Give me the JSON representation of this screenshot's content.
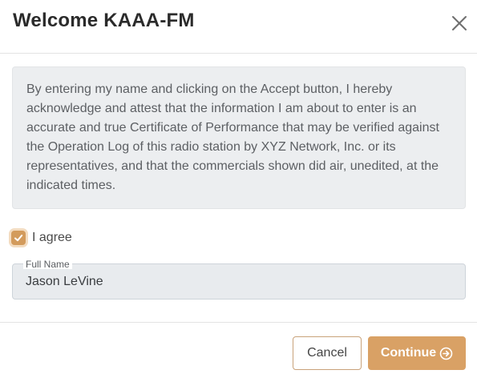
{
  "dialog": {
    "title": "Welcome KAAA-FM",
    "close_icon": "close-icon"
  },
  "notice": {
    "text": "By entering my name and clicking on the Accept button, I hereby acknowledge and attest that the information I am about to enter is an accurate and true Certificate of Performance that may be verified against the Operation Log of this radio station by XYZ Network, Inc. or its representatives, and that the commercials shown did air, unedited, at the indicated times."
  },
  "agree": {
    "label": "I agree",
    "checked": true,
    "icon": "checkmark-icon"
  },
  "full_name": {
    "label": "Full Name",
    "value": "Jason LeVine"
  },
  "footer": {
    "cancel_label": "Cancel",
    "continue_label": "Continue",
    "continue_icon": "arrow-right-circle-icon"
  },
  "colors": {
    "accent": "#d9a165",
    "checkbox": "#d39b5c",
    "notice_bg": "#eceef0",
    "field_bg": "#e8ebee"
  }
}
